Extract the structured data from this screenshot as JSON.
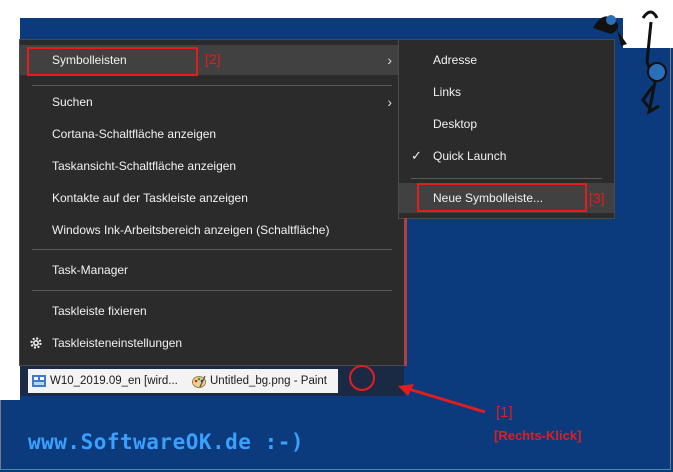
{
  "menu": {
    "items": [
      {
        "label": "Symbolleisten",
        "submenu": true
      },
      {
        "label": "Suchen",
        "submenu": true
      },
      {
        "label": "Cortana-Schaltfläche anzeigen"
      },
      {
        "label": "Taskansicht-Schaltfläche anzeigen"
      },
      {
        "label": "Kontakte auf der Taskleiste anzeigen"
      },
      {
        "label": "Windows Ink-Arbeitsbereich anzeigen (Schaltfläche)"
      },
      {
        "label": "Task-Manager"
      },
      {
        "label": "Taskleiste fixieren"
      },
      {
        "label": "Taskleisteneinstellungen",
        "icon": "gear-icon"
      }
    ],
    "submenu_chevron": "›"
  },
  "submenu": {
    "items": [
      {
        "label": "Adresse"
      },
      {
        "label": "Links"
      },
      {
        "label": "Desktop"
      },
      {
        "label": "Quick Launch",
        "checked": true
      },
      {
        "label": "Neue Symbolleiste..."
      }
    ],
    "check": "✓"
  },
  "annotations": {
    "a1": "[1]",
    "a1_sub": "[Rechts-Klick]",
    "a2": "[2]",
    "a3": "[3]"
  },
  "taskbar": {
    "items": [
      {
        "label": "W10_2019.09_en [wird..."
      },
      {
        "label": "Untitled_bg.png - Paint"
      }
    ]
  },
  "footer": "www.SoftwareOK.de :-)",
  "colors": {
    "highlight": "#e21d1d",
    "menu_bg": "#2b2b2b",
    "desktop_bg": "#0b3b7c"
  }
}
